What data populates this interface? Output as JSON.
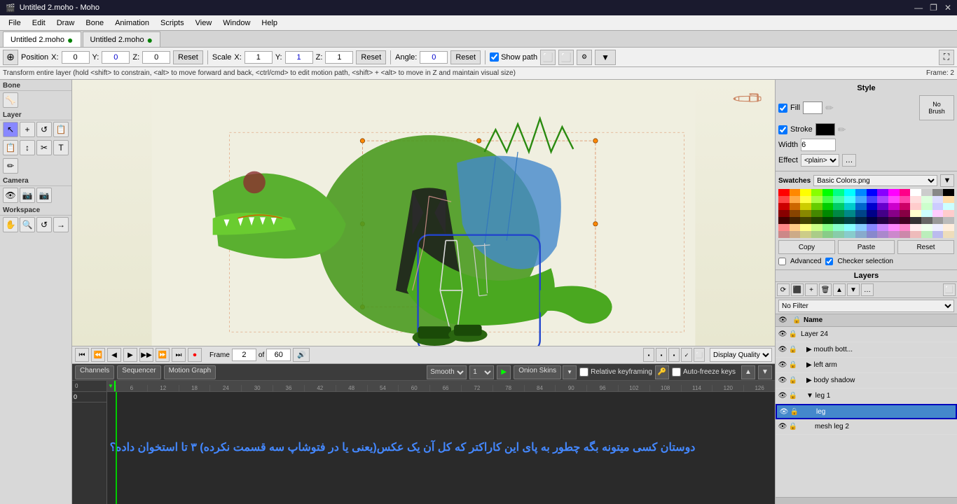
{
  "app": {
    "title": "Untitled 2.moho - Moho"
  },
  "titlebar": {
    "title": "Untitled 2.moho - Moho",
    "minimize": "—",
    "maximize": "❐",
    "close": "✕"
  },
  "menubar": {
    "items": [
      "File",
      "Edit",
      "Draw",
      "Bone",
      "Animation",
      "Scripts",
      "View",
      "Window",
      "Help"
    ]
  },
  "tabs": [
    {
      "label": "Untitled 2.moho",
      "dot": "●",
      "active": true
    },
    {
      "label": "Untitled 2.moho",
      "dot": "●",
      "active": false
    }
  ],
  "toolbar": {
    "position_label": "Position",
    "x_label": "X:",
    "x_val": "0",
    "y_label": "Y:",
    "y_val": "0",
    "z_label": "Z:",
    "z_val": "0",
    "reset1": "Reset",
    "scale_label": "Scale",
    "sx_label": "X:",
    "sx_val": "1",
    "sy_label": "Y:",
    "sy_val": "1",
    "sz_label": "Z:",
    "sz_val": "1",
    "reset2": "Reset",
    "angle_label": "Angle:",
    "angle_val": "0",
    "reset3": "Reset",
    "show_path": "Show path"
  },
  "statusbar": {
    "message": "Transform entire layer (hold <shift> to constrain, <alt> to move forward and back, <ctrl/cmd> to edit motion path, <shift> + <alt> to move in Z and maintain visual size)",
    "frame_label": "Frame:",
    "frame_val": "2"
  },
  "left_tools": {
    "sections": [
      {
        "title": "Bone",
        "tools": [
          "🦴"
        ]
      },
      {
        "title": "Layer",
        "tools": [
          "↖",
          "+",
          "↺",
          "📋",
          "📋",
          "↕",
          "✂",
          "T",
          "🖊"
        ]
      },
      {
        "title": "Camera",
        "tools": [
          "👁",
          "📷",
          "📷"
        ]
      },
      {
        "title": "Workspace",
        "tools": [
          "✋",
          "🔍",
          "↺",
          "→"
        ]
      }
    ]
  },
  "style_panel": {
    "title": "Style",
    "fill_label": "Fill",
    "stroke_label": "Stroke",
    "width_label": "Width",
    "width_val": "6",
    "effect_label": "Effect",
    "effect_val": "<plain>",
    "no_brush": "No\nBrush"
  },
  "swatches_panel": {
    "title": "Swatches",
    "name": "Basic Colors.png",
    "colors": [
      "#ff0000",
      "#ff8800",
      "#ffff00",
      "#88ff00",
      "#00ff00",
      "#00ff88",
      "#00ffff",
      "#0088ff",
      "#0000ff",
      "#8800ff",
      "#ff00ff",
      "#ff0088",
      "#ffffff",
      "#cccccc",
      "#888888",
      "#000000",
      "#ff4444",
      "#ffaa44",
      "#ffff44",
      "#aaff44",
      "#44ff44",
      "#44ffaa",
      "#44ffff",
      "#44aaff",
      "#4444ff",
      "#aa44ff",
      "#ff44ff",
      "#ff44aa",
      "#ffdddd",
      "#ddffdd",
      "#ddddff",
      "#ffddaa",
      "#cc0000",
      "#cc6600",
      "#cccc00",
      "#66cc00",
      "#00cc00",
      "#00cc66",
      "#00cccc",
      "#0066cc",
      "#0000cc",
      "#6600cc",
      "#cc00cc",
      "#cc0066",
      "#ffcccc",
      "#ccffcc",
      "#ccccff",
      "#ccffff",
      "#880000",
      "#884400",
      "#888800",
      "#448800",
      "#008800",
      "#008844",
      "#008888",
      "#004488",
      "#000088",
      "#440088",
      "#880088",
      "#880044",
      "#ffffcc",
      "#ccffff",
      "#ffccff",
      "#ffcccc",
      "#440000",
      "#442200",
      "#444400",
      "#224400",
      "#004400",
      "#004422",
      "#004444",
      "#002244",
      "#000044",
      "#220044",
      "#440044",
      "#440022",
      "#333333",
      "#666666",
      "#999999",
      "#bbbbbb",
      "#ff8888",
      "#ffcc88",
      "#ffff88",
      "#ccff88",
      "#88ff88",
      "#88ffcc",
      "#88ffff",
      "#88ccff",
      "#8888ff",
      "#cc88ff",
      "#ff88ff",
      "#ff88cc",
      "#ffeeee",
      "#eeffee",
      "#eeeeff",
      "#ffeedd",
      "#cc8888",
      "#ccaa88",
      "#cccc88",
      "#aacc88",
      "#88cc88",
      "#88ccaa",
      "#88cccc",
      "#88aacc",
      "#8888cc",
      "#aa88cc",
      "#cc88cc",
      "#cc88aa",
      "#eebbbb",
      "#bbeebb",
      "#bbbbee",
      "#eeddbb"
    ],
    "copy_btn": "Copy",
    "paste_btn": "Paste",
    "reset_btn": "Reset",
    "advanced_label": "Advanced",
    "checker_label": "Checker selection"
  },
  "layers_panel": {
    "title": "Layers",
    "filter_label": "No Filter",
    "name_col": "Name",
    "layers": [
      {
        "name": "Layer 24",
        "indent": 0,
        "eye": true,
        "lock": false,
        "visible": true
      },
      {
        "name": "mouth bott...",
        "indent": 1,
        "eye": true,
        "lock": false,
        "group": true
      },
      {
        "name": "left arm",
        "indent": 1,
        "eye": true,
        "lock": false,
        "group": true
      },
      {
        "name": "body shadow",
        "indent": 1,
        "eye": true,
        "lock": false,
        "group": true
      },
      {
        "name": "leg 1",
        "indent": 1,
        "eye": true,
        "lock": false,
        "group": true,
        "expanded": true
      },
      {
        "name": "leg",
        "indent": 2,
        "eye": true,
        "lock": false,
        "selected": true,
        "highlighted": true
      },
      {
        "name": "mesh leg 2",
        "indent": 2,
        "eye": true,
        "lock": false
      }
    ]
  },
  "playback": {
    "buttons": [
      "⏮",
      "⏪",
      "◀",
      "▶",
      "▶▶",
      "⏩",
      "⏭",
      "⏺"
    ],
    "frame_label": "Frame",
    "frame_val": "2",
    "of_label": "of",
    "total_frames": "60",
    "display_quality": "Display Quality",
    "onion_label": "Onion Skins",
    "smooth_label": "Smooth",
    "onion_skins_label": "Onion Skins",
    "relative_key": "Relative keyframing",
    "auto_freeze": "Auto-freeze keys"
  },
  "timeline": {
    "channels_tab": "Channels",
    "sequencer_tab": "Sequencer",
    "motion_graph_tab": "Motion Graph",
    "smooth_label": "Smooth",
    "num_val": "1",
    "onion_label": "Onion Skins",
    "relative_key": "Relative keyframing",
    "auto_freeze": "Auto-freeze keys",
    "ruler_marks": [
      "6",
      "12",
      "18",
      "24",
      "30",
      "36",
      "42",
      "48",
      "54",
      "60",
      "66",
      "72",
      "78",
      "84",
      "90",
      "96",
      "102",
      "108",
      "114",
      "120",
      "126"
    ],
    "overlay_text": "دوستان کسی میتونه بگه چطور به پای این کاراکتر که کل آن یک عکس(یعنی یا در فتوشاپ سه قسمت نکرده) ۳ تا استخوان داده؟"
  }
}
